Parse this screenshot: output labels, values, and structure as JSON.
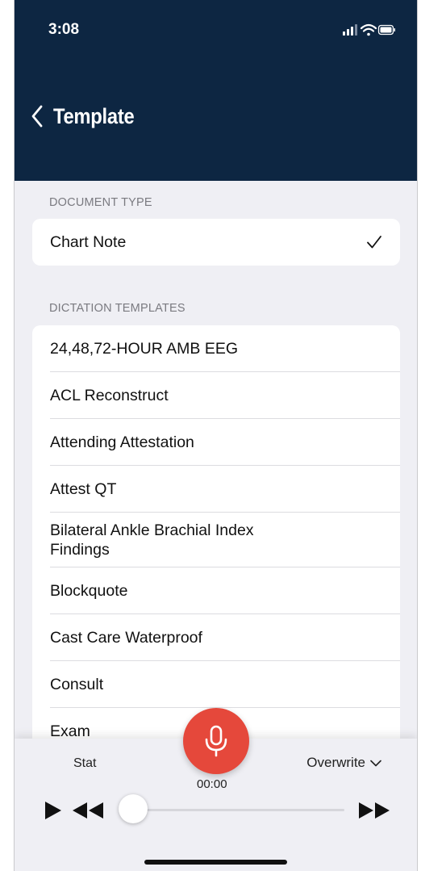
{
  "status_bar": {
    "time": "3:08"
  },
  "nav": {
    "back_icon": "chevron-left-icon",
    "title": "Template"
  },
  "document_type": {
    "section_label": "DOCUMENT TYPE",
    "selected": "Chart Note",
    "selected_icon": "checkmark-icon"
  },
  "dictation_templates": {
    "section_label": "DICTATION TEMPLATES",
    "items": [
      {
        "label": "24,48,72-HOUR AMB EEG"
      },
      {
        "label": "ACL Reconstruct"
      },
      {
        "label": "Attending Attestation"
      },
      {
        "label": "Attest QT"
      },
      {
        "label": "Bilateral Ankle Brachial Index Findings"
      },
      {
        "label": "Blockquote"
      },
      {
        "label": "Cast Care Waterproof"
      },
      {
        "label": "Consult"
      },
      {
        "label": "Exam"
      }
    ]
  },
  "recorder": {
    "priority_label": "Stat",
    "mode_label": "Overwrite",
    "timer": "00:00",
    "progress": 0,
    "mic_icon": "microphone-icon",
    "accent_color": "#e5483b"
  },
  "colors": {
    "header_bg": "#0d2642",
    "background": "#efeff4"
  }
}
